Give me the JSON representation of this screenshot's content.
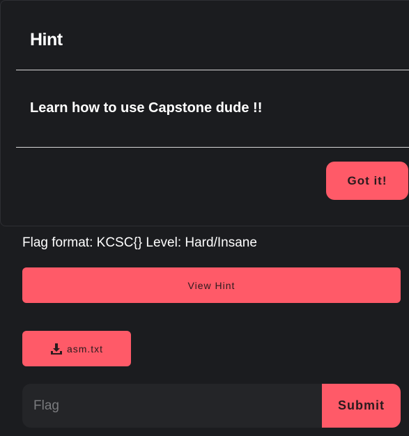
{
  "modal": {
    "title": "Hint",
    "body": "Learn how to use Capstone dude !!",
    "confirm_label": "Got it!"
  },
  "challenge": {
    "info": "Flag format: KCSC{} Level: Hard/Insane",
    "view_hint_label": "View Hint",
    "file_label": "asm.txt",
    "file_icon": "download-icon"
  },
  "flag_form": {
    "placeholder": "Flag",
    "value": "",
    "submit_label": "Submit"
  },
  "colors": {
    "accent": "#ff5a68",
    "background": "#1b1c1f",
    "input_bg": "#242528"
  }
}
